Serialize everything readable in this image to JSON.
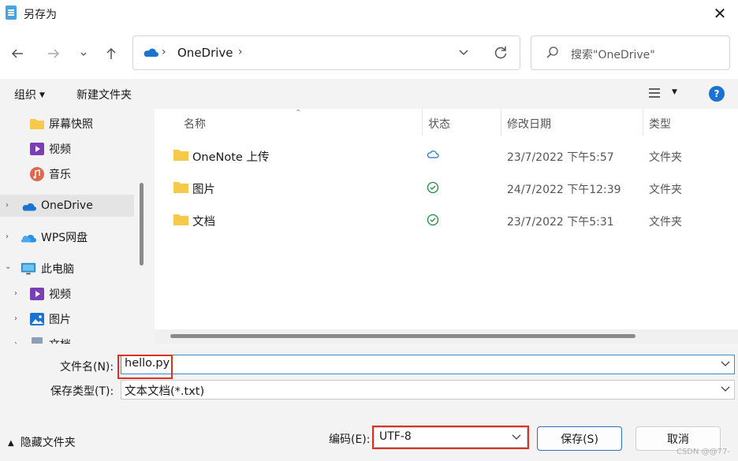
{
  "window": {
    "title": "另存为",
    "close_glyph": "✕"
  },
  "nav": {
    "back_icon": "arrow-left-icon",
    "forward_icon": "arrow-right-icon",
    "recent_icon": "chevron-down-icon",
    "up_icon": "arrow-up-icon",
    "address": {
      "crumb": "OneDrive",
      "separator": "›"
    },
    "search_placeholder": "搜索\"OneDrive\""
  },
  "cmdbar": {
    "organize": "组织",
    "new_folder": "新建文件夹",
    "help": "?"
  },
  "sidebar": {
    "items": [
      {
        "label": "屏幕快照",
        "icon": "folder-icon"
      },
      {
        "label": "视频",
        "icon": "video-icon"
      },
      {
        "label": "音乐",
        "icon": "music-icon"
      },
      {
        "label": "OneDrive",
        "icon": "onedrive-icon",
        "selected": true
      },
      {
        "label": "WPS网盘",
        "icon": "wps-cloud-icon"
      },
      {
        "label": "此电脑",
        "icon": "computer-icon"
      },
      {
        "label": "视频",
        "icon": "video-icon"
      },
      {
        "label": "图片",
        "icon": "picture-icon"
      },
      {
        "label": "文档",
        "icon": "document-icon"
      }
    ]
  },
  "files": {
    "columns": {
      "name": "名称",
      "status": "状态",
      "modified": "修改日期",
      "type": "类型"
    },
    "rows": [
      {
        "name": "OneNote 上传",
        "status": "cloud",
        "modified": "23/7/2022 下午5:57",
        "type": "文件夹"
      },
      {
        "name": "图片",
        "status": "synced",
        "modified": "24/7/2022 下午12:39",
        "type": "文件夹"
      },
      {
        "name": "文档",
        "status": "synced",
        "modified": "23/7/2022 下午5:31",
        "type": "文件夹"
      }
    ]
  },
  "form": {
    "filename_label": "文件名(N):",
    "filename_value": "hello.py",
    "filetype_label": "保存类型(T):",
    "filetype_value": "文本文档(*.txt)"
  },
  "footer": {
    "hide_folders": "隐藏文件夹",
    "encoding_label": "编码(E):",
    "encoding_value": "UTF-8",
    "save": "保存(S)",
    "cancel": "取消"
  },
  "watermark": "CSDN @@77-",
  "colors": {
    "accent": "#1b73d1",
    "highlight_box": "#e0301e",
    "sync_green": "#1e8a3c",
    "folder": "#f7c948"
  }
}
